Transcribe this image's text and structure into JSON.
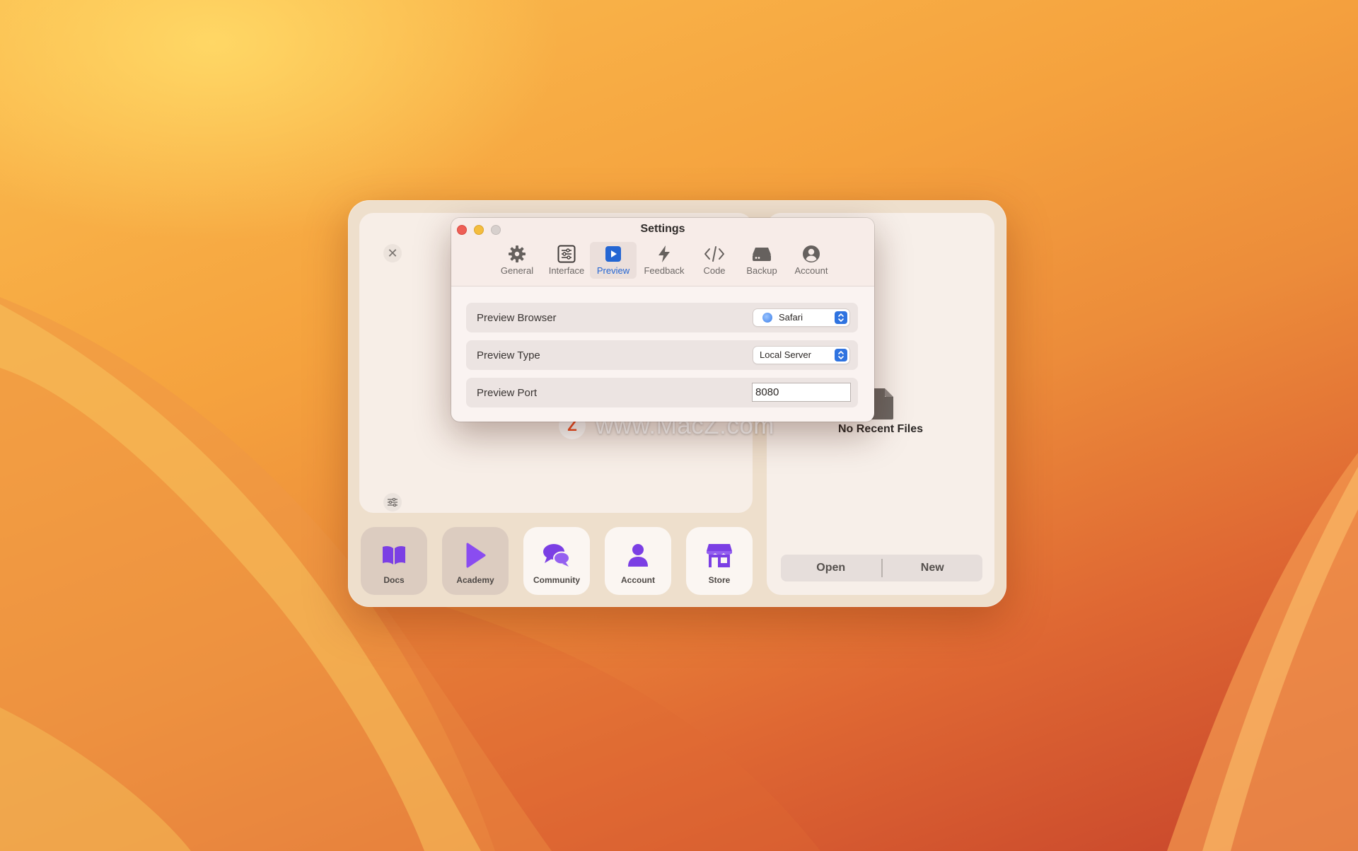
{
  "settings": {
    "title": "Settings",
    "tabs": [
      {
        "label": "General",
        "icon": "gear-icon"
      },
      {
        "label": "Interface",
        "icon": "sliders-icon"
      },
      {
        "label": "Preview",
        "icon": "play-icon",
        "active": true
      },
      {
        "label": "Feedback",
        "icon": "bolt-icon"
      },
      {
        "label": "Code",
        "icon": "code-icon"
      },
      {
        "label": "Backup",
        "icon": "drive-icon"
      },
      {
        "label": "Account",
        "icon": "user-circle-icon"
      }
    ],
    "rows": {
      "browser": {
        "label": "Preview Browser",
        "value": "Safari"
      },
      "type": {
        "label": "Preview Type",
        "value": "Local Server"
      },
      "port": {
        "label": "Preview Port",
        "value": "8080"
      }
    }
  },
  "launcher": {
    "recent": {
      "empty_text": "No Recent Files"
    },
    "open_label": "Open",
    "new_label": "New",
    "dock": [
      {
        "label": "Docs",
        "icon": "book-icon"
      },
      {
        "label": "Academy",
        "icon": "play-icon"
      },
      {
        "label": "Community",
        "icon": "chat-bubbles-icon"
      },
      {
        "label": "Account",
        "icon": "person-icon"
      },
      {
        "label": "Store",
        "icon": "store-icon"
      }
    ]
  },
  "watermark": {
    "logo": "Z",
    "text": "www.MacZ.com"
  },
  "colors": {
    "accent": "#2466d3",
    "dock_icon": "#7b3fe4",
    "close_red": "#ee5f56"
  }
}
